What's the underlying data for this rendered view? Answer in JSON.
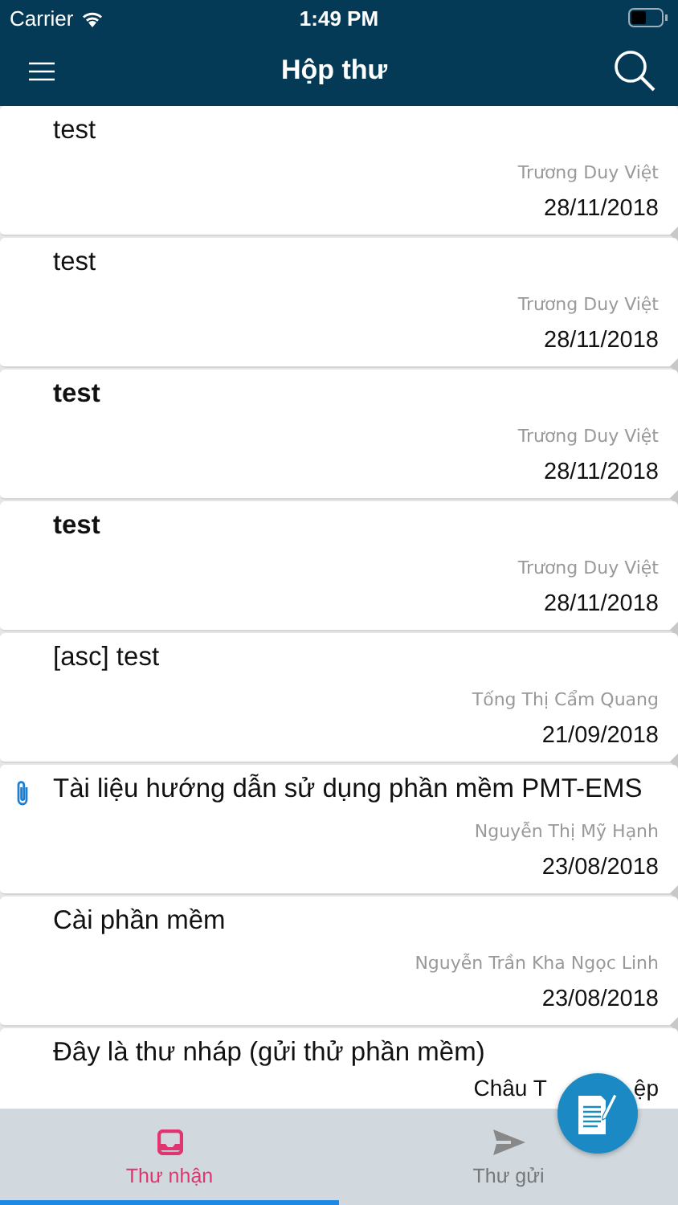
{
  "status_bar": {
    "carrier": "Carrier",
    "time": "1:49 PM"
  },
  "nav_bar": {
    "title": "Hộp thư"
  },
  "messages": [
    {
      "subject": "test",
      "sender": "Trương Duy Việt",
      "date": "28/11/2018",
      "unread": false,
      "attachment": false
    },
    {
      "subject": "test",
      "sender": "Trương Duy Việt",
      "date": "28/11/2018",
      "unread": false,
      "attachment": false
    },
    {
      "subject": "test",
      "sender": "Trương Duy Việt",
      "date": "28/11/2018",
      "unread": true,
      "attachment": false
    },
    {
      "subject": "test",
      "sender": "Trương Duy Việt",
      "date": "28/11/2018",
      "unread": true,
      "attachment": false
    },
    {
      "subject": "[asc] test",
      "sender": "Tống Thị Cẩm Quang",
      "date": "21/09/2018",
      "unread": false,
      "attachment": false
    },
    {
      "subject": "Tài liệu hướng dẫn sử dụng phần mềm PMT-EMS",
      "sender": "Nguyễn Thị Mỹ Hạnh",
      "date": "23/08/2018",
      "unread": false,
      "attachment": true
    },
    {
      "subject": "Cài phần mềm",
      "sender": "Nguyễn Trần Kha Ngọc Linh",
      "date": "23/08/2018",
      "unread": false,
      "attachment": false
    },
    {
      "subject": "Đây là thư nháp (gửi thử phần mềm)",
      "sender_fragments": [
        "Châu T",
        "ệp"
      ],
      "unread": false,
      "attachment": false
    }
  ],
  "tabs": [
    {
      "label": "Thư nhận",
      "kind": "inbox",
      "selected": true
    },
    {
      "label": "Thư gửi",
      "kind": "sent",
      "selected": false
    }
  ]
}
